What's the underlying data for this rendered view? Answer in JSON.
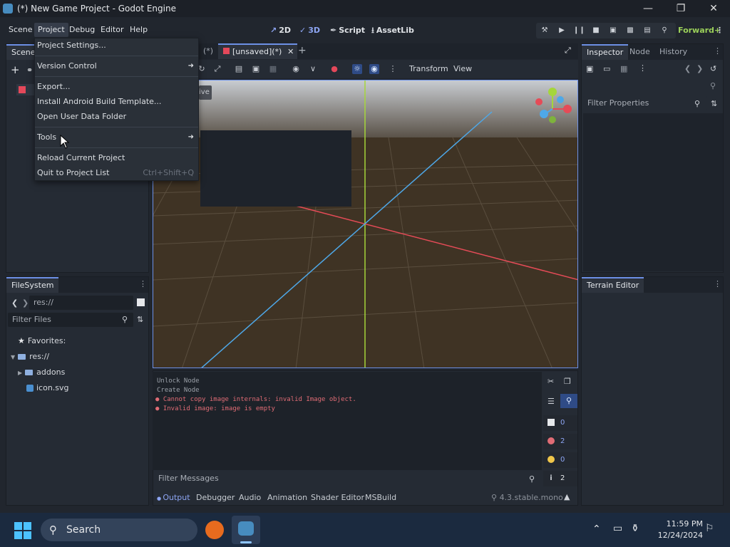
{
  "window": {
    "title": "(*) New Game Project - Godot Engine"
  },
  "menubar": {
    "items": [
      "Scene",
      "Project",
      "Debug",
      "Editor",
      "Help"
    ]
  },
  "main_screens": {
    "d2": "2D",
    "d3": "3D",
    "script": "Script",
    "assetlib": "AssetLib"
  },
  "renderer": "Forward+",
  "project_menu": {
    "items": [
      {
        "label": "Project Settings...",
        "shortcut": ""
      },
      {
        "label": "Version Control",
        "shortcut": ""
      },
      {
        "label": "Export...",
        "shortcut": ""
      },
      {
        "label": "Install Android Build Template...",
        "shortcut": ""
      },
      {
        "label": "Open User Data Folder",
        "shortcut": ""
      },
      {
        "label": "Tools",
        "shortcut": ""
      },
      {
        "label": "Reload Current Project",
        "shortcut": ""
      },
      {
        "label": "Quit to Project List",
        "shortcut": "Ctrl+Shift+Q"
      }
    ]
  },
  "scene_dock": {
    "tab": "Scene"
  },
  "editor_tab": {
    "label": "[unsaved](*)",
    "partial": "(*)"
  },
  "viewport_toolbar": {
    "transform": "Transform",
    "view": "View",
    "perspective_partial": "ive"
  },
  "inspector": {
    "tabs": [
      "Inspector",
      "Node",
      "History"
    ],
    "filter_placeholder": "Filter Properties"
  },
  "filesystem": {
    "tab": "FileSystem",
    "path": "res://",
    "filter_placeholder": "Filter Files",
    "tree": {
      "favorites": "Favorites:",
      "root": "res://",
      "addons": "addons",
      "icon": "icon.svg"
    }
  },
  "terrain_editor": {
    "tab": "Terrain Editor"
  },
  "output": {
    "lines": [
      {
        "text": "Unlock Node",
        "type": "info"
      },
      {
        "text": "Create Node",
        "type": "info"
      },
      {
        "text": "Cannot copy image internals: invalid Image object.",
        "type": "error"
      },
      {
        "text": "Invalid image: image is empty",
        "type": "error"
      }
    ],
    "filter_placeholder": "Filter Messages",
    "counts": {
      "messages": "0",
      "errors": "2",
      "warnings": "0",
      "info": "2"
    }
  },
  "bottom_panel": {
    "tabs": [
      "Output",
      "Debugger",
      "Audio",
      "Animation",
      "Shader Editor",
      "MSBuild"
    ],
    "version": "4.3.stable.mono"
  },
  "taskbar": {
    "search": "Search",
    "time": "11:59 PM",
    "date": "12/24/2024"
  },
  "colors": {
    "accent": "#6d90e6",
    "error": "#e06c75",
    "x_axis": "#e54b57",
    "y_axis": "#a5d63a",
    "z_axis": "#4ea8e8"
  }
}
